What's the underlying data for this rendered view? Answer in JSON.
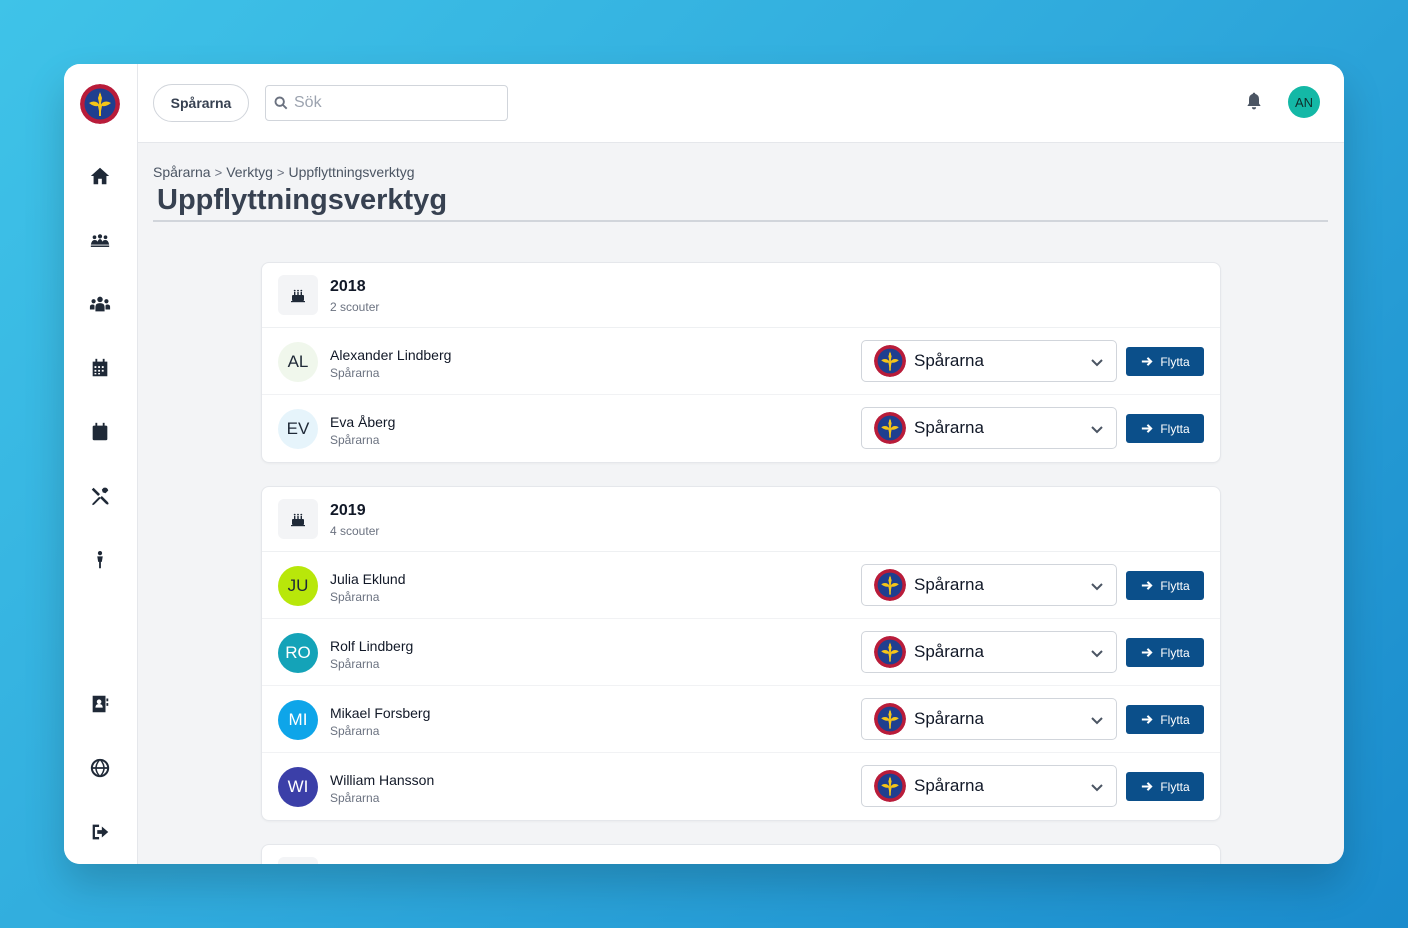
{
  "header": {
    "org_label": "Spårarna",
    "search_placeholder": "Sök",
    "user_initials": "AN"
  },
  "breadcrumb": [
    "Spårarna",
    "Verktyg",
    "Uppflyttningsverktyg"
  ],
  "page_title": "Uppflyttningsverktyg",
  "sidebar": {
    "icons": [
      "home-icon",
      "troop-icon",
      "people-icon",
      "calendar-grid-icon",
      "calendar-icon",
      "tools-icon",
      "scout-person-icon",
      "contact-card-icon",
      "globe-icon",
      "logout-icon"
    ]
  },
  "groups": [
    {
      "year": "2018",
      "count": "2 scouter",
      "members": [
        {
          "initials": "AL",
          "name": "Alexander Lindberg",
          "unit": "Spårarna",
          "select": "Spårarna",
          "button": "Flytta",
          "avatar_bg": "#f0f7ec",
          "avatar_fg": "#1f2937"
        },
        {
          "initials": "EV",
          "name": "Eva Åberg",
          "unit": "Spårarna",
          "select": "Spårarna",
          "button": "Flytta",
          "avatar_bg": "#e6f4fb",
          "avatar_fg": "#1f2937"
        }
      ]
    },
    {
      "year": "2019",
      "count": "4 scouter",
      "members": [
        {
          "initials": "JU",
          "name": "Julia Eklund",
          "unit": "Spårarna",
          "select": "Spårarna",
          "button": "Flytta",
          "avatar_bg": "#b8e70a",
          "avatar_fg": "#1f2937"
        },
        {
          "initials": "RO",
          "name": "Rolf Lindberg",
          "unit": "Spårarna",
          "select": "Spårarna",
          "button": "Flytta",
          "avatar_bg": "#14a3b8",
          "avatar_fg": "#ffffff"
        },
        {
          "initials": "MI",
          "name": "Mikael Forsberg",
          "unit": "Spårarna",
          "select": "Spårarna",
          "button": "Flytta",
          "avatar_bg": "#0ea5e9",
          "avatar_fg": "#ffffff"
        },
        {
          "initials": "WI",
          "name": "William Hansson",
          "unit": "Spårarna",
          "select": "Spårarna",
          "button": "Flytta",
          "avatar_bg": "#3b3fa8",
          "avatar_fg": "#ffffff"
        }
      ]
    }
  ],
  "colors": {
    "primary_button": "#0b4f8a",
    "user_avatar": "#14b8a6",
    "background_gradient_start": "#3fc3e8",
    "background_gradient_end": "#1a8bcc"
  }
}
